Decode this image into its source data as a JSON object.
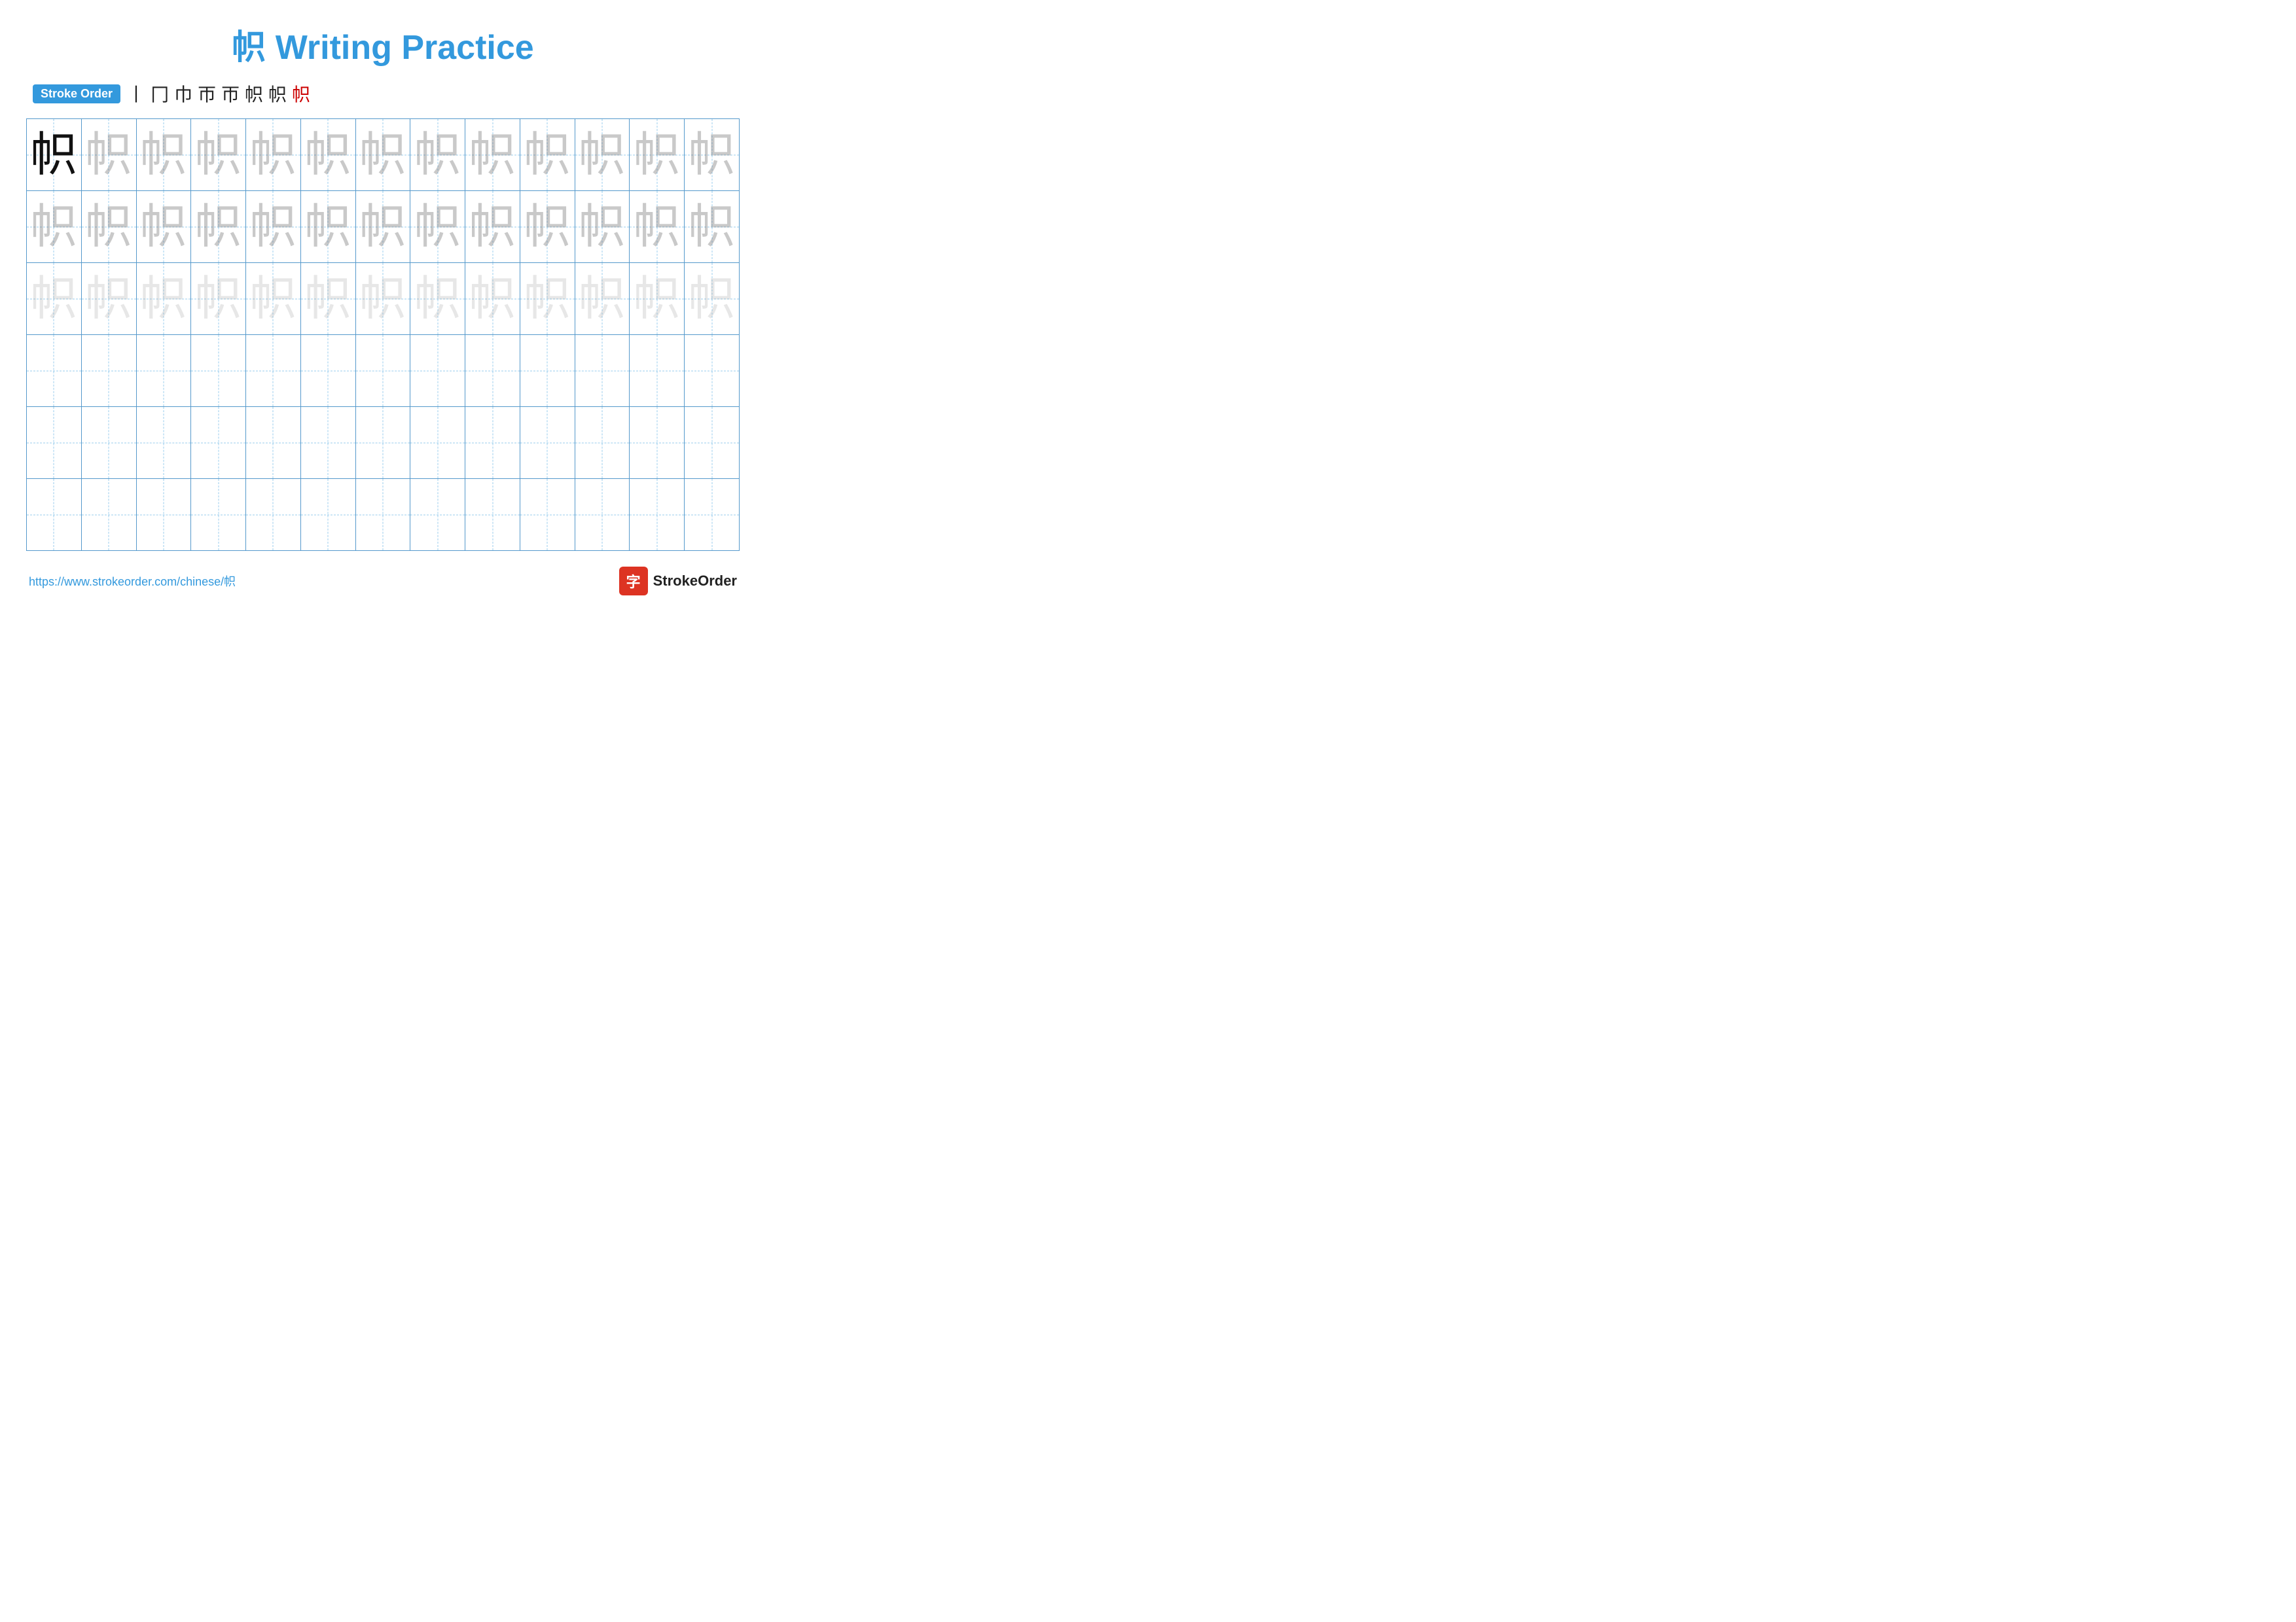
{
  "title": "帜 Writing Practice",
  "stroke_order_label": "Stroke Order",
  "stroke_sequence": [
    "丨",
    "冂",
    "巾",
    "帀",
    "帀",
    "帜",
    "帜",
    "帜"
  ],
  "main_char": "帜",
  "footer_url": "https://www.strokeorder.com/chinese/帜",
  "footer_logo_text": "StrokeOrder",
  "footer_logo_icon": "字",
  "rows": [
    {
      "cells": [
        {
          "type": "solid"
        },
        {
          "type": "faded-dark"
        },
        {
          "type": "faded-dark"
        },
        {
          "type": "faded-dark"
        },
        {
          "type": "faded-dark"
        },
        {
          "type": "faded-dark"
        },
        {
          "type": "faded-dark"
        },
        {
          "type": "faded-dark"
        },
        {
          "type": "faded-dark"
        },
        {
          "type": "faded-dark"
        },
        {
          "type": "faded-dark"
        },
        {
          "type": "faded-dark"
        },
        {
          "type": "faded-dark"
        }
      ]
    },
    {
      "cells": [
        {
          "type": "faded-dark"
        },
        {
          "type": "faded-dark"
        },
        {
          "type": "faded-dark"
        },
        {
          "type": "faded-dark"
        },
        {
          "type": "faded-dark"
        },
        {
          "type": "faded-dark"
        },
        {
          "type": "faded-dark"
        },
        {
          "type": "faded-dark"
        },
        {
          "type": "faded-dark"
        },
        {
          "type": "faded-dark"
        },
        {
          "type": "faded-dark"
        },
        {
          "type": "faded-dark"
        },
        {
          "type": "faded-dark"
        }
      ]
    },
    {
      "cells": [
        {
          "type": "faded-light"
        },
        {
          "type": "faded-light"
        },
        {
          "type": "faded-light"
        },
        {
          "type": "faded-light"
        },
        {
          "type": "faded-light"
        },
        {
          "type": "faded-light"
        },
        {
          "type": "faded-light"
        },
        {
          "type": "faded-light"
        },
        {
          "type": "faded-light"
        },
        {
          "type": "faded-light"
        },
        {
          "type": "faded-light"
        },
        {
          "type": "faded-light"
        },
        {
          "type": "faded-light"
        }
      ]
    },
    {
      "cells": [
        {
          "type": "empty"
        },
        {
          "type": "empty"
        },
        {
          "type": "empty"
        },
        {
          "type": "empty"
        },
        {
          "type": "empty"
        },
        {
          "type": "empty"
        },
        {
          "type": "empty"
        },
        {
          "type": "empty"
        },
        {
          "type": "empty"
        },
        {
          "type": "empty"
        },
        {
          "type": "empty"
        },
        {
          "type": "empty"
        },
        {
          "type": "empty"
        }
      ]
    },
    {
      "cells": [
        {
          "type": "empty"
        },
        {
          "type": "empty"
        },
        {
          "type": "empty"
        },
        {
          "type": "empty"
        },
        {
          "type": "empty"
        },
        {
          "type": "empty"
        },
        {
          "type": "empty"
        },
        {
          "type": "empty"
        },
        {
          "type": "empty"
        },
        {
          "type": "empty"
        },
        {
          "type": "empty"
        },
        {
          "type": "empty"
        },
        {
          "type": "empty"
        }
      ]
    },
    {
      "cells": [
        {
          "type": "empty"
        },
        {
          "type": "empty"
        },
        {
          "type": "empty"
        },
        {
          "type": "empty"
        },
        {
          "type": "empty"
        },
        {
          "type": "empty"
        },
        {
          "type": "empty"
        },
        {
          "type": "empty"
        },
        {
          "type": "empty"
        },
        {
          "type": "empty"
        },
        {
          "type": "empty"
        },
        {
          "type": "empty"
        },
        {
          "type": "empty"
        }
      ]
    }
  ]
}
